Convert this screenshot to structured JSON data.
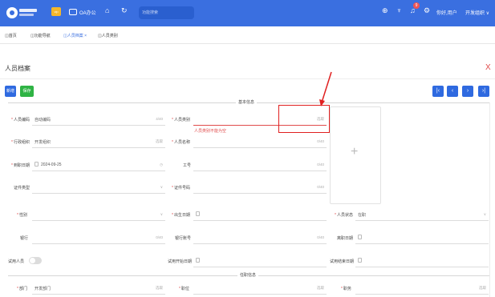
{
  "topbar": {
    "logo_vip": "vip",
    "oa_label": "OA办公",
    "search_placeholder": "功能搜索",
    "notification_count": "9",
    "user_label": "你好,用户",
    "org_switch": "开发组织 ∨",
    "colors": {
      "bar": "#3a6fe0",
      "badge": "#f05454"
    }
  },
  "tabs": [
    {
      "label": "◫首页"
    },
    {
      "label": "◫功能导航"
    },
    {
      "label": "◫人员档案 ×"
    },
    {
      "label": "◫人员类别"
    }
  ],
  "page": {
    "title": "人员档案",
    "close": "X",
    "btn_new": "新增",
    "btn_save": "保存",
    "nav": [
      "|‹",
      "‹",
      "›",
      "›|"
    ]
  },
  "sections": {
    "basic": "基本信息",
    "job": "任职信息"
  },
  "fields": {
    "code": {
      "label": "人员编码",
      "value": "自动编码",
      "suffix": "4/40"
    },
    "category": {
      "label": "人员类别",
      "suffix": "选取",
      "error": "人员类别不能为空"
    },
    "org": {
      "label": "行政组织",
      "value": "开发组织",
      "suffix": "选取"
    },
    "name": {
      "label": "人员名称",
      "suffix": "0/40"
    },
    "entry_date": {
      "label": "到职日期",
      "value": "2024-09-25",
      "suffix": "◷"
    },
    "job_no": {
      "label": "工号",
      "suffix": "0/40"
    },
    "id_type": {
      "label": "证件类型",
      "suffix": "∨"
    },
    "id_no": {
      "label": "证件号码",
      "suffix": "0/40"
    },
    "gender": {
      "label": "性别",
      "suffix": "∨"
    },
    "birth_date": {
      "label": "出生日期"
    },
    "status": {
      "label": "人员状态",
      "value": "在职",
      "suffix": "∨"
    },
    "bank": {
      "label": "银行",
      "suffix": "0/40"
    },
    "bank_account": {
      "label": "银行账号",
      "suffix": "0/40"
    },
    "leave_date": {
      "label": "离职日期"
    },
    "probation": {
      "label": "试用人员"
    },
    "probation_start": {
      "label": "试用开始日期"
    },
    "probation_end": {
      "label": "试用结束日期"
    },
    "dept": {
      "label": "部门",
      "value": "开发部门",
      "suffix": "选取"
    },
    "position": {
      "label": "职位",
      "suffix": "选取"
    },
    "post": {
      "label": "职务",
      "suffix": "选取"
    }
  }
}
